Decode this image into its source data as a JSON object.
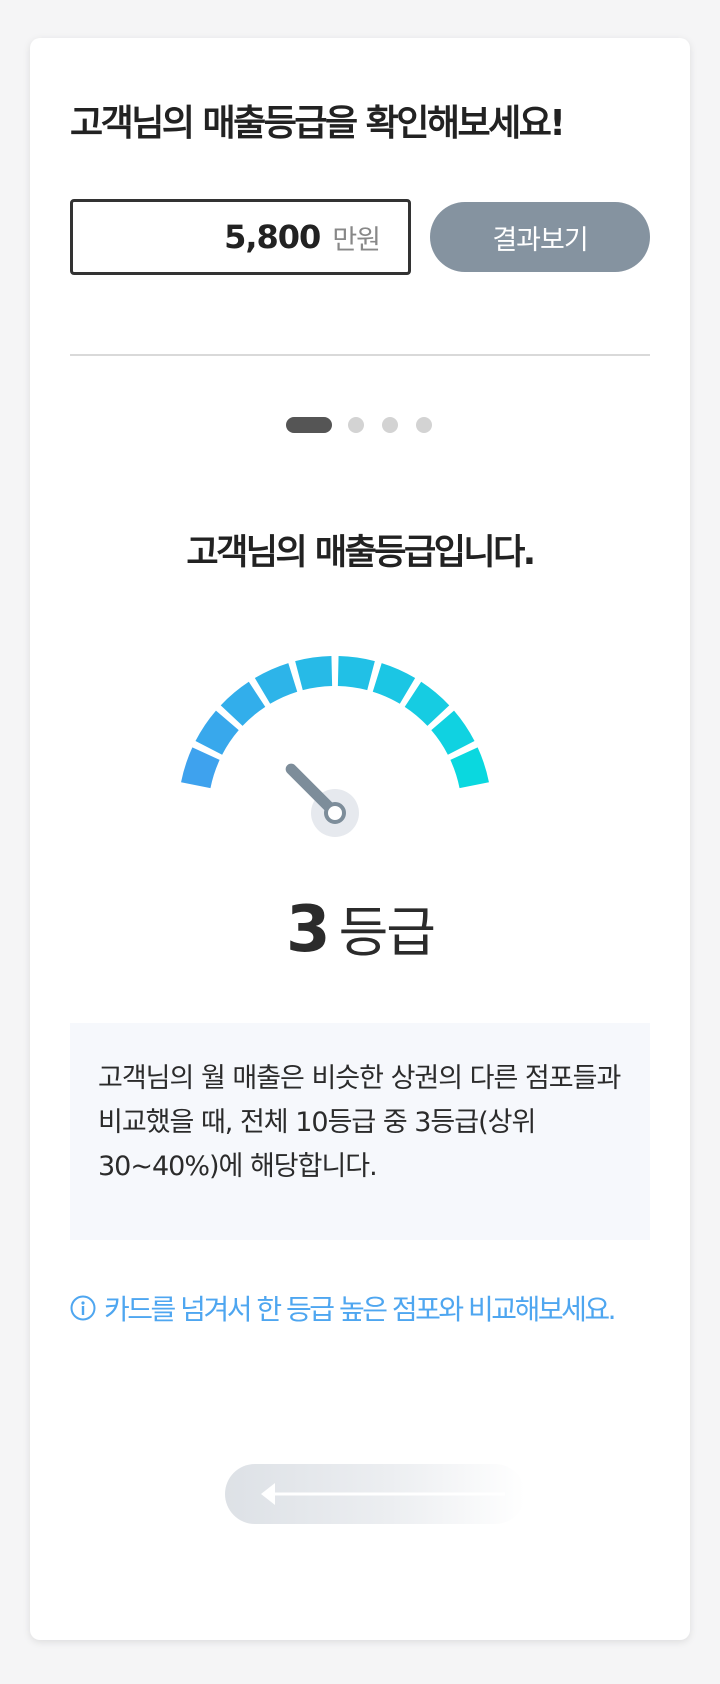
{
  "header": {
    "title": "고객님의 매출등급을 확인해보세요!"
  },
  "input": {
    "value": "5,800",
    "unit": "만원"
  },
  "result_button": {
    "label": "결과보기"
  },
  "pager": {
    "total_pages": 4,
    "active_page": 1
  },
  "result": {
    "subtitle": "고객님의 매출등급입니다.",
    "grade_number": "3",
    "grade_unit": "등급",
    "gauge_level_fraction": 0.25,
    "description": "고객님의 월 매출은 비슷한 상권의 다른 점포들과 비교했을 때, 전체 10등급 중 3등급(상위 30~40%)에 해당합니다."
  },
  "tip": {
    "icon": "info-icon",
    "text": "카드를 넘겨서 한 등급 높은 점포와 비교해보세요."
  },
  "swipe": {
    "icon": "arrow-left-icon"
  },
  "colors": {
    "button_bg": "#8593a0",
    "gauge_start": "#3ea2ee",
    "gauge_end": "#0ad8df",
    "tip_text": "#4ea6f0",
    "needle": "#7d8d9a"
  }
}
